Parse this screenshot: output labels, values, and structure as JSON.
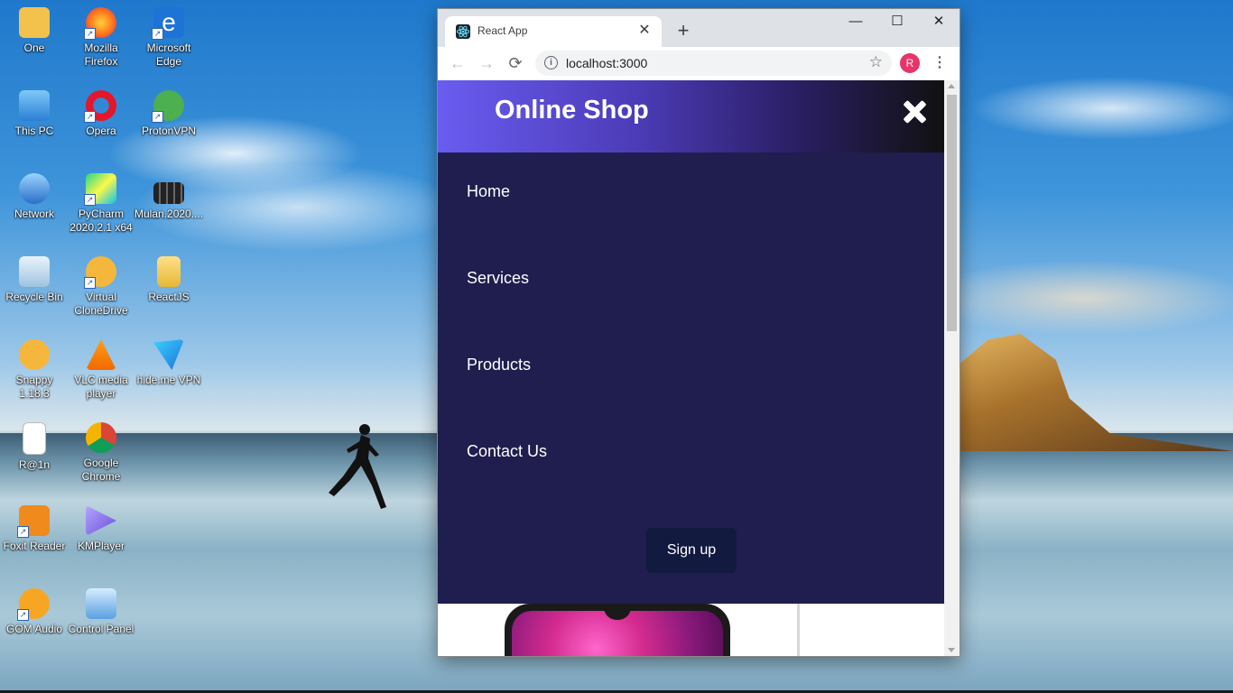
{
  "desktop": {
    "icons": [
      {
        "label": "One"
      },
      {
        "label": "Mozilla Firefox"
      },
      {
        "label": "Microsoft Edge"
      },
      {
        "label": "This PC"
      },
      {
        "label": "Opera"
      },
      {
        "label": "ProtonVPN"
      },
      {
        "label": "Network"
      },
      {
        "label": "PyCharm 2020.2.1 x64"
      },
      {
        "label": "Mulan.2020...."
      },
      {
        "label": "Recycle Bin"
      },
      {
        "label": "Virtual CloneDrive"
      },
      {
        "label": "ReactJS"
      },
      {
        "label": "Snappy 1.18.3"
      },
      {
        "label": "VLC media player"
      },
      {
        "label": "hide.me VPN"
      },
      {
        "label": "R@1n"
      },
      {
        "label": "Google Chrome"
      },
      {
        "label": "Foxit Reader"
      },
      {
        "label": "KMPlayer"
      },
      {
        "label": "GOM Audio"
      },
      {
        "label": "Control Panel"
      }
    ]
  },
  "browser": {
    "tab_title": "React App",
    "tab_close": "✕",
    "new_tab": "+",
    "url": "localhost:3000",
    "profile_initial": "R",
    "win_minimize": "—",
    "win_maximize": "☐",
    "win_close": "✕"
  },
  "site": {
    "brand": "Online Shop",
    "nav": [
      "Home",
      "Services",
      "Products",
      "Contact Us"
    ],
    "signup_label": "Sign up",
    "colors": {
      "header_start": "#6a5cf0",
      "header_end": "#111111",
      "menu_bg": "#1f1e4e",
      "button_bg": "#131a3f"
    }
  }
}
